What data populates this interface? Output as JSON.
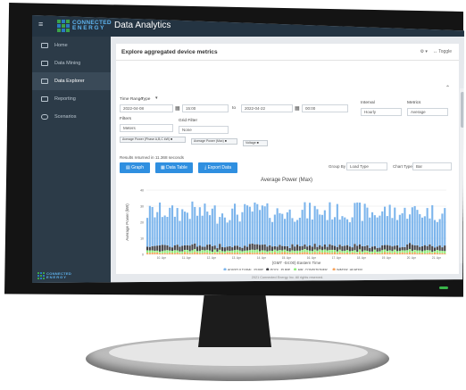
{
  "brand": {
    "line1": "CONNECTED",
    "line2": "ENERGY"
  },
  "app_title": "Data Analytics",
  "sidebar": {
    "items": [
      {
        "label": "Home",
        "icon": "monitor-icon"
      },
      {
        "label": "Data Mining",
        "icon": "database-icon"
      },
      {
        "label": "Data Explorer",
        "icon": "chart-icon",
        "active": true
      },
      {
        "label": "Reporting",
        "icon": "document-icon"
      },
      {
        "label": "Scenarios",
        "icon": "cloud-icon"
      }
    ]
  },
  "panel": {
    "title": "Explore aggregated device metrics",
    "tools": [
      "⚙ ▾",
      "↔ Toggle"
    ]
  },
  "form": {
    "time_range_label": "Time Range",
    "type_label": "Type",
    "start_date": "2022-04-08",
    "start_time": "15:00",
    "to_label": "to",
    "end_date": "2022-04-22",
    "end_time": "00:00",
    "interval_label": "Interval",
    "interval_value": "Hourly",
    "metrics_label": "Metrics",
    "metrics_value": "Average",
    "filters_label": "Filters",
    "filter_by_value": "Meters",
    "grid_filter_label": "Grid Filter",
    "grid_filter_value": "None",
    "chips": [
      "Average Power (Phase A,B,C kW) ■",
      "Average Power (Max) ■",
      "Voltage ■"
    ]
  },
  "results_text": "Results returned in 11.368 seconds",
  "buttons": {
    "graph": "▤ Graph",
    "data_table": "▦ Data Table",
    "export": "⤓ Export Data"
  },
  "controls": {
    "group_by_label": "Group By",
    "group_by_value": "Load Type",
    "chart_type_label": "Chart Type",
    "chart_type_value": "Bar"
  },
  "chart_data": {
    "type": "bar",
    "title": "Average Power (Max)",
    "ylabel": "Average Power (kW)",
    "xlabel": "(GMT -04:00) Eastern Time",
    "ylim": [
      0,
      40
    ],
    "yticks": [
      0,
      10,
      20,
      30,
      40
    ],
    "xticks": [
      "10. Apr",
      "11. Apr",
      "12. Apr",
      "13. Apr",
      "14. Apr",
      "15. Apr",
      "16. Apr",
      "17. Apr",
      "18. Apr",
      "19. Apr",
      "20. Apr",
      "21. Apr"
    ],
    "stacked": true,
    "series": [
      {
        "name": "AGRICULTURAL_PUMP",
        "color": "#7cb5ec",
        "value_range": [
          15,
          27
        ]
      },
      {
        "name": "POOL_PUMP",
        "color": "#434348",
        "value_range": [
          2,
          4
        ]
      },
      {
        "name": "AIR_CONDITIONER",
        "color": "#90ed7d",
        "value_range": [
          1,
          2
        ]
      },
      {
        "name": "WATER_HEATER",
        "color": "#f7a35c",
        "value_range": [
          0.5,
          1.5
        ]
      }
    ]
  },
  "footer_text": "2021 Connected Energy Inc. All rights reserved.",
  "side_logo": {
    "line1": "CONNECTED",
    "line2": "ENERGY"
  }
}
